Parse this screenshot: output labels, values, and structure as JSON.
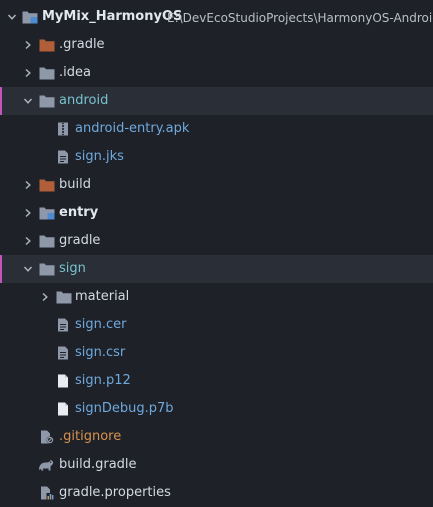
{
  "tree": {
    "root": {
      "label": "MyMix_HarmonyOS",
      "path": "E:\\DevEcoStudioProjects\\HarmonyOS-Android"
    },
    "items": [
      {
        "label": ".gradle"
      },
      {
        "label": ".idea"
      },
      {
        "label": "android"
      },
      {
        "label": "android-entry.apk"
      },
      {
        "label": "sign.jks"
      },
      {
        "label": "build"
      },
      {
        "label": "entry"
      },
      {
        "label": "gradle"
      },
      {
        "label": "sign"
      },
      {
        "label": "material"
      },
      {
        "label": "sign.cer"
      },
      {
        "label": "sign.csr"
      },
      {
        "label": "sign.p12"
      },
      {
        "label": "signDebug.p7b"
      },
      {
        "label": ".gitignore"
      },
      {
        "label": "build.gradle"
      },
      {
        "label": "gradle.properties"
      }
    ]
  },
  "icons": {
    "chevron_right": "chevron-right-icon",
    "chevron_down": "chevron-down-icon",
    "folder": "folder-icon",
    "module_folder": "module-folder-icon",
    "apk_file": "apk-file-icon",
    "text_file": "text-file-icon",
    "blank_file": "blank-file-icon",
    "gitignore_file": "gitignore-file-icon",
    "gradle_file": "gradle-icon",
    "properties_file": "properties-file-icon"
  },
  "colors": {
    "background": "#1e2228",
    "selected_row": "#2a2e36",
    "selection_marker": "#c255b8",
    "folder": "#8f98a8",
    "excluded_folder": "#b05f38",
    "module_accent": "#4f8ccf",
    "text": "#bcc2cc",
    "filename_blue": "#6fa8dc",
    "filename_cyan": "#78c2cf",
    "filename_orange": "#d8914e"
  }
}
